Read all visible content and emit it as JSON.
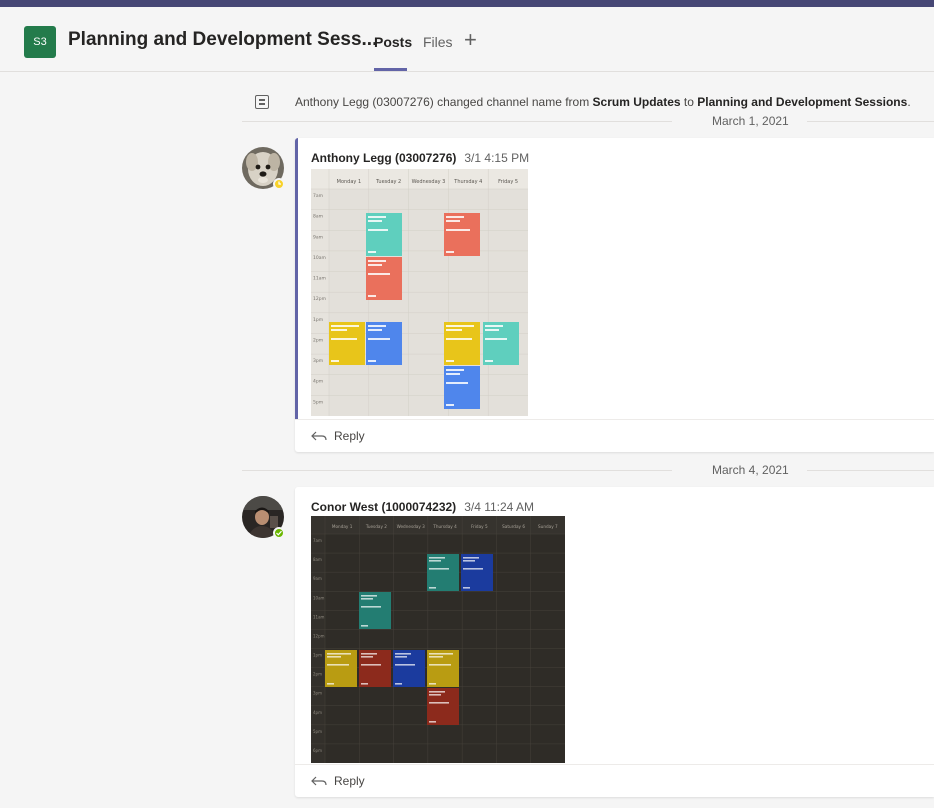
{
  "header": {
    "team_initials": "S3",
    "channel_name": "Planning and Development Sess...",
    "tabs": [
      {
        "label": "Posts"
      },
      {
        "label": "Files"
      }
    ],
    "add_tab_symbol": "+"
  },
  "event": {
    "actor": "Anthony Legg (03007276)",
    "text1": " changed channel name from ",
    "old_name": "Scrum Updates",
    "text2": " to ",
    "new_name": "Planning and Development Sessions",
    "text3": "."
  },
  "dates": [
    "March 1, 2021",
    "March 4, 2021"
  ],
  "messages": [
    {
      "author": "Anthony Legg (03007276)",
      "time": "3/1 4:15 PM",
      "status": "away",
      "reply_label": "Reply",
      "image": {
        "theme": "light",
        "days": [
          "Monday 1",
          "Tuesday 2",
          "Wednesday 3",
          "Thursday 4",
          "Friday 5"
        ],
        "hours": [
          "7am",
          "8am",
          "9am",
          "10am",
          "11am",
          "12pm",
          "1pm",
          "2pm",
          "3pm",
          "4pm",
          "5pm"
        ]
      }
    },
    {
      "author": "Conor West (1000074232)",
      "time": "3/4 11:24 AM",
      "status": "available",
      "reply_label": "Reply",
      "image": {
        "theme": "dark",
        "days": [
          "Monday 1",
          "Tuesday 2",
          "Wednesday 3",
          "Thursday 4",
          "Friday 5",
          "Saturday 6",
          "Sunday 7"
        ],
        "hours": [
          "7am",
          "8am",
          "9am",
          "10am",
          "11am",
          "12pm",
          "1pm",
          "2pm",
          "3pm",
          "4pm",
          "5pm",
          "6pm"
        ]
      }
    }
  ],
  "colors": {
    "accent": "#6264a7",
    "team_avatar": "#237b4b",
    "away": "#f8d22a",
    "available": "#6bb700"
  }
}
